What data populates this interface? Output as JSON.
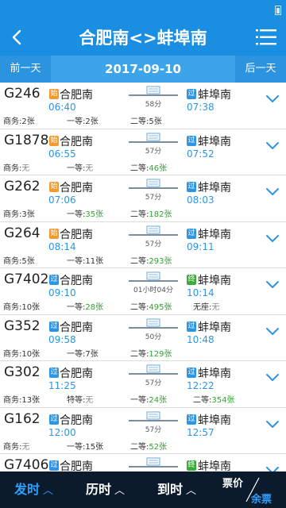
{
  "header": {
    "title": "合肥南<>蚌埠南"
  },
  "datebar": {
    "prev": "前一天",
    "date": "2017-09-10",
    "next": "后一天"
  },
  "trains": [
    {
      "no": "G246",
      "dep_badge": "始",
      "dep_badge_color": "orange",
      "dep": "合肥南",
      "dep_time": "06:40",
      "dur": "58分",
      "arr_badge": "过",
      "arr_badge_color": "blue",
      "arr": "蚌埠南",
      "arr_time": "07:38",
      "seats": [
        {
          "label": "商务:",
          "value": "2张",
          "tone": "gray"
        },
        {
          "label": "一等:",
          "value": "2张",
          "tone": "gray"
        },
        {
          "label": "二等:",
          "value": "5张",
          "tone": "gray"
        }
      ]
    },
    {
      "no": "G1878",
      "dep_badge": "始",
      "dep_badge_color": "orange",
      "dep": "合肥南",
      "dep_time": "06:55",
      "dur": "57分",
      "arr_badge": "过",
      "arr_badge_color": "blue",
      "arr": "蚌埠南",
      "arr_time": "07:52",
      "seats": [
        {
          "label": "商务:",
          "value": "无",
          "tone": "none"
        },
        {
          "label": "一等:",
          "value": "无",
          "tone": "none"
        },
        {
          "label": "二等:",
          "value": "46张",
          "tone": "green"
        }
      ]
    },
    {
      "no": "G262",
      "dep_badge": "始",
      "dep_badge_color": "orange",
      "dep": "合肥南",
      "dep_time": "07:06",
      "dur": "57分",
      "arr_badge": "过",
      "arr_badge_color": "blue",
      "arr": "蚌埠南",
      "arr_time": "08:03",
      "seats": [
        {
          "label": "商务:",
          "value": "3张",
          "tone": "gray"
        },
        {
          "label": "一等:",
          "value": "35张",
          "tone": "green"
        },
        {
          "label": "二等:",
          "value": "182张",
          "tone": "green"
        }
      ]
    },
    {
      "no": "G264",
      "dep_badge": "始",
      "dep_badge_color": "orange",
      "dep": "合肥南",
      "dep_time": "08:14",
      "dur": "57分",
      "arr_badge": "过",
      "arr_badge_color": "blue",
      "arr": "蚌埠南",
      "arr_time": "09:11",
      "seats": [
        {
          "label": "商务:",
          "value": "5张",
          "tone": "gray"
        },
        {
          "label": "一等:",
          "value": "11张",
          "tone": "gray"
        },
        {
          "label": "二等:",
          "value": "293张",
          "tone": "green"
        }
      ]
    },
    {
      "no": "G7402",
      "dep_badge": "过",
      "dep_badge_color": "blue",
      "dep": "合肥南",
      "dep_time": "09:10",
      "dur": "01小时04分",
      "arr_badge": "终",
      "arr_badge_color": "green",
      "arr": "蚌埠南",
      "arr_time": "10:14",
      "seats": [
        {
          "label": "商务:",
          "value": "10张",
          "tone": "gray"
        },
        {
          "label": "一等:",
          "value": "28张",
          "tone": "green"
        },
        {
          "label": "二等:",
          "value": "495张",
          "tone": "green"
        },
        {
          "label": "无座:",
          "value": "无",
          "tone": "none"
        }
      ]
    },
    {
      "no": "G352",
      "dep_badge": "过",
      "dep_badge_color": "blue",
      "dep": "合肥南",
      "dep_time": "09:58",
      "dur": "50分",
      "arr_badge": "过",
      "arr_badge_color": "blue",
      "arr": "蚌埠南",
      "arr_time": "10:48",
      "seats": [
        {
          "label": "商务:",
          "value": "10张",
          "tone": "gray"
        },
        {
          "label": "一等:",
          "value": "7张",
          "tone": "gray"
        },
        {
          "label": "二等:",
          "value": "129张",
          "tone": "green"
        }
      ]
    },
    {
      "no": "G302",
      "dep_badge": "过",
      "dep_badge_color": "blue",
      "dep": "合肥南",
      "dep_time": "11:25",
      "dur": "57分",
      "arr_badge": "过",
      "arr_badge_color": "blue",
      "arr": "蚌埠南",
      "arr_time": "12:22",
      "seats": [
        {
          "label": "商务:",
          "value": "13张",
          "tone": "gray"
        },
        {
          "label": "特等:",
          "value": "无",
          "tone": "none"
        },
        {
          "label": "一等:",
          "value": "24张",
          "tone": "green"
        },
        {
          "label": "二等:",
          "value": "354张",
          "tone": "green"
        }
      ]
    },
    {
      "no": "G162",
      "dep_badge": "过",
      "dep_badge_color": "blue",
      "dep": "合肥南",
      "dep_time": "12:00",
      "dur": "57分",
      "arr_badge": "过",
      "arr_badge_color": "blue",
      "arr": "蚌埠南",
      "arr_time": "12:57",
      "seats": [
        {
          "label": "商务:",
          "value": "无",
          "tone": "none"
        },
        {
          "label": "一等:",
          "value": "15张",
          "tone": "gray"
        },
        {
          "label": "二等:",
          "value": "52张",
          "tone": "green"
        }
      ]
    },
    {
      "no": "G7406",
      "dep_badge": "过",
      "dep_badge_color": "blue",
      "dep": "合肥南",
      "dep_time": "",
      "dur": "",
      "arr_badge": "终",
      "arr_badge_color": "green",
      "arr": "蚌埠南",
      "arr_time": "",
      "seats": []
    }
  ],
  "bottombar": {
    "depart": "发时",
    "duration": "历时",
    "arrive": "到时",
    "price": "票价",
    "remaining": "余票"
  },
  "colors": {
    "primary": "#1a8ee0",
    "time_blue": "#2d95e3",
    "green": "#2ea52e",
    "orange": "#f39a2b",
    "dark_bar": "#0b1b2c"
  }
}
